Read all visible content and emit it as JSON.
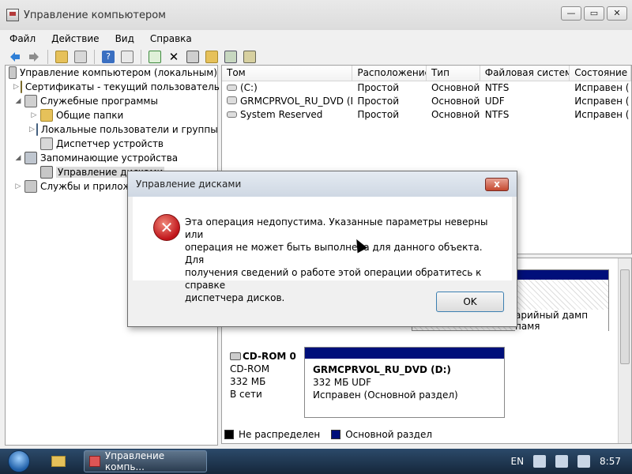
{
  "window": {
    "title": "Управление компьютером",
    "controls": {
      "minimize": "—",
      "maximize": "▭",
      "close": "✕"
    }
  },
  "menu": [
    "Файл",
    "Действие",
    "Вид",
    "Справка"
  ],
  "toolbar_icons": [
    "back-icon",
    "forward-icon",
    "up-folder-icon",
    "show-hide-tree-icon",
    "help-icon",
    "properties-icon",
    "refresh-icon",
    "delete-icon",
    "settings-icon",
    "open-folder-icon",
    "search-icon",
    "disk-properties-icon"
  ],
  "tree": {
    "root": "Управление компьютером (локальным)",
    "items": [
      {
        "label": "Сертификаты - текущий пользователь",
        "level": 1,
        "exp": "▷"
      },
      {
        "label": "Служебные программы",
        "level": 1,
        "exp": "◢"
      },
      {
        "label": "Общие папки",
        "level": 2,
        "exp": "▷"
      },
      {
        "label": "Локальные пользователи и группы",
        "level": 2,
        "exp": "▷"
      },
      {
        "label": "Диспетчер устройств",
        "level": 2,
        "exp": ""
      },
      {
        "label": "Запоминающие устройства",
        "level": 1,
        "exp": "◢"
      },
      {
        "label": "Управление дисками",
        "level": 2,
        "exp": ""
      },
      {
        "label": "Службы и приложения",
        "level": 1,
        "exp": "▷"
      }
    ]
  },
  "volumes": {
    "columns": [
      "Том",
      "Расположение",
      "Тип",
      "Файловая система",
      "Состояние"
    ],
    "rows": [
      [
        "(C:)",
        "Простой",
        "Основной",
        "NTFS",
        "Исправен ("
      ],
      [
        "GRMCPRVOL_RU_DVD (D:)",
        "Простой",
        "Основной",
        "UDF",
        "Исправен ("
      ],
      [
        "System Reserved",
        "Простой",
        "Основной",
        "NTFS",
        "Исправен ("
      ]
    ]
  },
  "disk_view": {
    "partial_partition_text": "арийный дамп памя",
    "cdrom": {
      "name": "CD-ROM 0",
      "type": "CD-ROM",
      "size": "332 МБ",
      "status": "В сети",
      "partition": {
        "name": "GRMCPRVOL_RU_DVD  (D:)",
        "size": "332 МБ UDF",
        "status": "Исправен (Основной раздел)"
      }
    },
    "legend": {
      "unallocated": "Не распределен",
      "primary": "Основной раздел"
    }
  },
  "dialog": {
    "title": "Управление дисками",
    "message": "Эта операция недопустима.  Указанные параметры неверны или\nоперация не может быть выполнена для данного объекта.  Для\nполучения сведений о работе этой операции обратитесь к справке\nдиспетчера дисков.",
    "ok": "OK",
    "close": "x"
  },
  "taskbar": {
    "active_app": "Управление компь...",
    "language": "EN",
    "time": "8:57"
  },
  "colors": {
    "primary_partition": "#000f7a",
    "unallocated": "#000000"
  }
}
